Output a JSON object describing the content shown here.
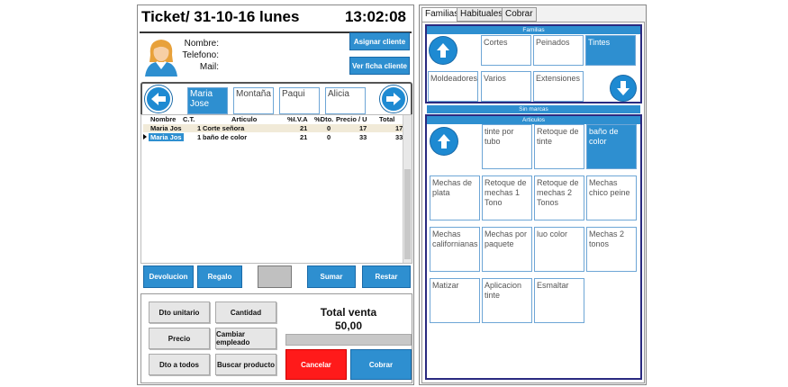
{
  "ticket": {
    "title": "Ticket/ 31-10-16 lunes",
    "time": "13:02:08"
  },
  "client": {
    "labels": {
      "name": "Nombre:",
      "phone": "Telefono:",
      "mail": "Mail:"
    },
    "assign_button": "Asignar cliente",
    "view_button": "Ver ficha cliente",
    "avatar_icon": "client-avatar-icon"
  },
  "employees": {
    "items": [
      "Maria Jose",
      "Montaña",
      "Paqui",
      "Alicia"
    ],
    "selected": 0,
    "left_icon": "arrow-left-icon",
    "right_icon": "arrow-right-icon"
  },
  "grid": {
    "headers": [
      "Nombre",
      "C.T.",
      "Articulo",
      "%I.V.A",
      "%Dto.",
      "Precio / U",
      "Total"
    ],
    "rows": [
      [
        "Maria Jos",
        "1",
        "Corte señora",
        "21",
        "0",
        "17",
        "17"
      ],
      [
        "Maria Jos",
        "1",
        "baño de color",
        "21",
        "0",
        "33",
        "33"
      ]
    ]
  },
  "actions": {
    "devolucion": "Devolucion",
    "regalo": "Regalo",
    "sumar": "Sumar",
    "restar": "Restar"
  },
  "bottom": {
    "dto_unitario": "Dto unitario",
    "cantidad": "Cantidad",
    "precio": "Precio",
    "cambiar_empleado": "Cambiar empleado",
    "dto_todos": "Dto a todos",
    "buscar_producto": "Buscar producto",
    "total_label": "Total venta",
    "total_value": "50,00",
    "cancelar": "Cancelar",
    "cobrar": "Cobrar"
  },
  "tabs": [
    "Familias",
    "Habituales",
    "Cobrar"
  ],
  "familias": {
    "header": "Familias",
    "row1": [
      "Cortes",
      "Peinados",
      "Tintes"
    ],
    "row2": [
      "Moldeadores",
      "Varios",
      "Extensiones"
    ],
    "selected": "Tintes",
    "up_icon": "arrow-up-icon",
    "down_icon": "arrow-down-icon"
  },
  "marcas": {
    "header": "Sin marcas"
  },
  "articulos": {
    "header": "Articulos",
    "row1": [
      "tinte por tubo",
      "Retoque de tinte",
      "baño de color"
    ],
    "row2": [
      "Mechas de plata",
      "Retoque de mechas 1 Tono",
      "Retoque de mechas 2 Tonos",
      "Mechas chico peine"
    ],
    "row3": [
      "Mechas californianas",
      "Mechas por paquete",
      "luo color",
      "Mechas 2 tonos"
    ],
    "row4": [
      "Matizar",
      "Aplicacion tinte",
      "Esmaltar"
    ],
    "selected": "baño de color"
  },
  "colors": {
    "accent": "#2e8fd0",
    "cancel": "#ff1a1a",
    "panel_border": "#2a2a80"
  }
}
